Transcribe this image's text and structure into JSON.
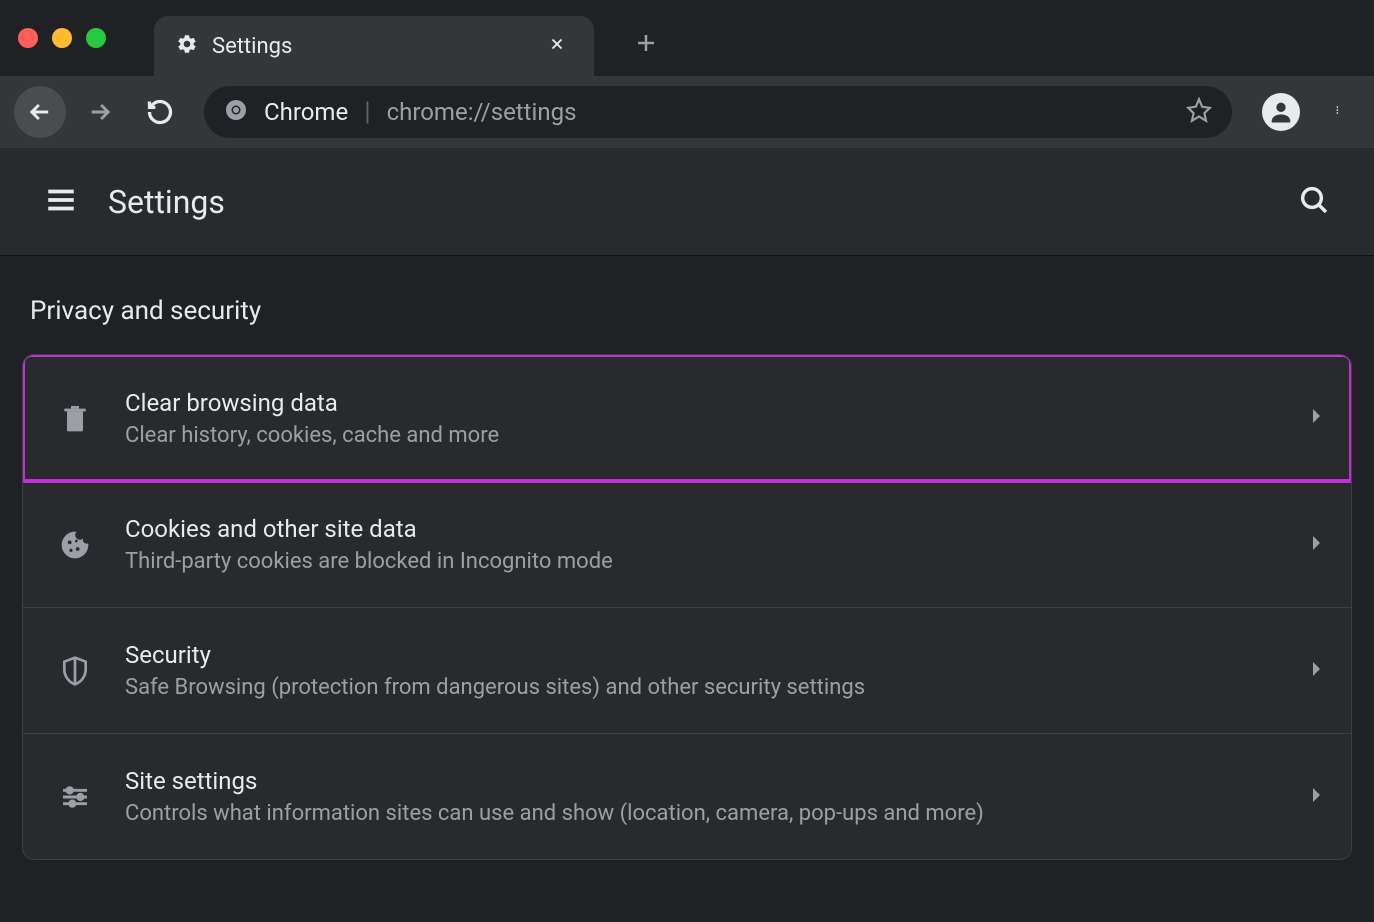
{
  "tab": {
    "title": "Settings"
  },
  "omnibox": {
    "chip_label": "Chrome",
    "url": "chrome://settings"
  },
  "header": {
    "title": "Settings"
  },
  "section": {
    "heading": "Privacy and security",
    "rows": [
      {
        "title": "Clear browsing data",
        "subtitle": "Clear history, cookies, cache and more"
      },
      {
        "title": "Cookies and other site data",
        "subtitle": "Third-party cookies are blocked in Incognito mode"
      },
      {
        "title": "Security",
        "subtitle": "Safe Browsing (protection from dangerous sites) and other security settings"
      },
      {
        "title": "Site settings",
        "subtitle": "Controls what information sites can use and show (location, camera, pop-ups and more)"
      }
    ]
  },
  "colors": {
    "highlight": "#c030d8"
  }
}
